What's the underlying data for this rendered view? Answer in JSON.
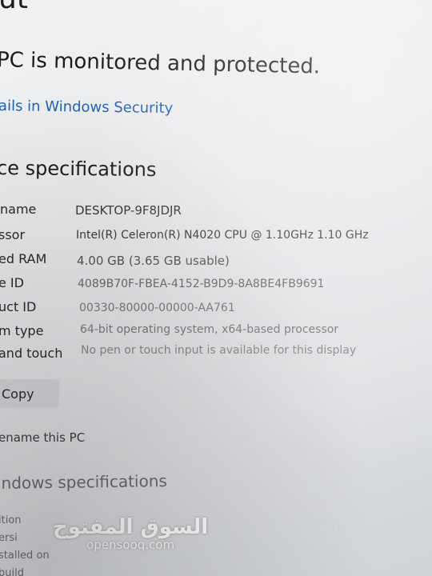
{
  "header": {
    "title_fragment": "ut",
    "protection_text": "PC is monitored and protected.",
    "security_link": "ails in Windows Security"
  },
  "device_specs": {
    "heading": "ce specifications",
    "rows": [
      {
        "label": "name",
        "value": "DESKTOP-9F8JDJR"
      },
      {
        "label": "ssor",
        "value": "Intel(R) Celeron(R) N4020 CPU @ 1.10GHz   1.10 GHz"
      },
      {
        "label": "ed RAM",
        "value": "4.00 GB (3.65 GB usable)"
      },
      {
        "label": "e ID",
        "value": "4089B70F-FBEA-4152-B9D9-8A8BE4FB9691"
      },
      {
        "label": "uct ID",
        "value": "00330-80000-00000-AA761"
      },
      {
        "label": "m type",
        "value": "64-bit operating system, x64-based processor"
      },
      {
        "label": "and touch",
        "value": "No pen or touch input is available for this display"
      }
    ],
    "copy_button": "Copy",
    "rename_link": "ename this PC"
  },
  "windows_specs": {
    "heading": "indows specifications",
    "partial_labels": [
      "ition",
      "ersi",
      "stalled on",
      "build"
    ]
  },
  "watermark": {
    "arabic": "السوق المفتوح",
    "latin": "opensooq.com"
  }
}
